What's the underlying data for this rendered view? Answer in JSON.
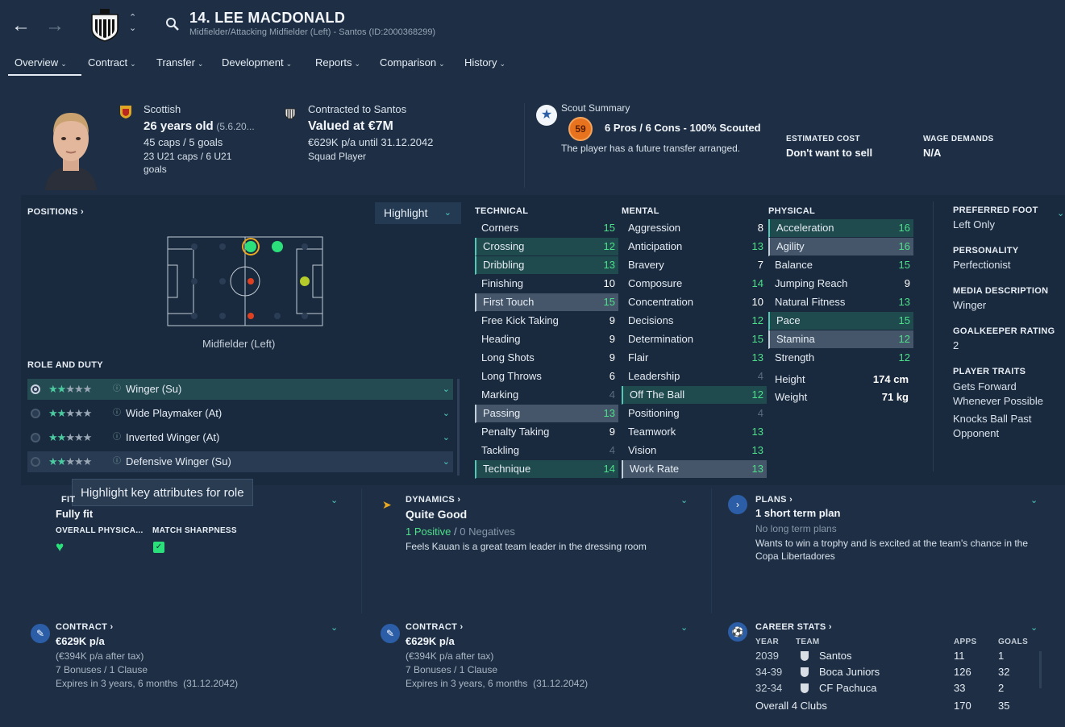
{
  "header": {
    "player_title": "14. LEE MACDONALD",
    "player_subtitle": "Midfielder/Attacking Midfielder (Left) - Santos (ID:2000368299)",
    "tabs": [
      "Overview",
      "Contract",
      "Transfer",
      "Development",
      "Reports",
      "Comparison",
      "History"
    ]
  },
  "info": {
    "nationality": "Scottish",
    "age": "26 years old",
    "dob": "(5.6.20...",
    "caps": "45 caps / 5 goals",
    "u21_caps": "23 U21 caps / 6 U21",
    "u21_goals": "goals",
    "contract_head": "Contracted to Santos",
    "value": "Valued at €7M",
    "wage": "€629K p/a until 31.12.2042",
    "squad_status": "Squad Player",
    "scout_head": "Scout Summary",
    "scout_rating": "59",
    "scout_line": "6 Pros / 6 Cons - 100% Scouted",
    "scout_note": "The player has a future transfer arranged.",
    "est_cost_label": "ESTIMATED COST",
    "est_cost_value": "Don't want to sell",
    "wage_demands_label": "WAGE DEMANDS",
    "wage_demands_value": "N/A"
  },
  "positions": {
    "label": "POSITIONS",
    "highlight": "Highlight",
    "position_name": "Midfielder (Left)",
    "role_duty_label": "ROLE AND DUTY",
    "roles": [
      {
        "stars_full": 2,
        "name": "Winger (Su)"
      },
      {
        "stars_full": 2,
        "name": "Wide Playmaker (At)"
      },
      {
        "stars_full": 2,
        "name": "Inverted Winger (At)"
      },
      {
        "stars_full": 2,
        "name": "Defensive Winger (Su)"
      }
    ],
    "tooltip": "Highlight key attributes for role"
  },
  "attributes": {
    "technical_label": "TECHNICAL",
    "mental_label": "MENTAL",
    "physical_label": "PHYSICAL",
    "technical": [
      {
        "name": "Corners",
        "value": "15",
        "style": "",
        "color": "g"
      },
      {
        "name": "Crossing",
        "value": "12",
        "style": "hl",
        "color": "g"
      },
      {
        "name": "Dribbling",
        "value": "13",
        "style": "hl",
        "color": "g"
      },
      {
        "name": "Finishing",
        "value": "10",
        "style": "",
        "color": "w"
      },
      {
        "name": "First Touch",
        "value": "15",
        "style": "gr",
        "color": "g"
      },
      {
        "name": "Free Kick Taking",
        "value": "9",
        "style": "",
        "color": "w"
      },
      {
        "name": "Heading",
        "value": "9",
        "style": "",
        "color": "w"
      },
      {
        "name": "Long Shots",
        "value": "9",
        "style": "",
        "color": "w"
      },
      {
        "name": "Long Throws",
        "value": "6",
        "style": "",
        "color": "w"
      },
      {
        "name": "Marking",
        "value": "4",
        "style": "",
        "color": "d"
      },
      {
        "name": "Passing",
        "value": "13",
        "style": "gr",
        "color": "g"
      },
      {
        "name": "Penalty Taking",
        "value": "9",
        "style": "",
        "color": "w"
      },
      {
        "name": "Tackling",
        "value": "4",
        "style": "",
        "color": "d"
      },
      {
        "name": "Technique",
        "value": "14",
        "style": "hl",
        "color": "g"
      }
    ],
    "mental": [
      {
        "name": "Aggression",
        "value": "8",
        "style": "",
        "color": "w"
      },
      {
        "name": "Anticipation",
        "value": "13",
        "style": "",
        "color": "g"
      },
      {
        "name": "Bravery",
        "value": "7",
        "style": "",
        "color": "w"
      },
      {
        "name": "Composure",
        "value": "14",
        "style": "",
        "color": "g"
      },
      {
        "name": "Concentration",
        "value": "10",
        "style": "",
        "color": "w"
      },
      {
        "name": "Decisions",
        "value": "12",
        "style": "",
        "color": "g"
      },
      {
        "name": "Determination",
        "value": "15",
        "style": "",
        "color": "g"
      },
      {
        "name": "Flair",
        "value": "13",
        "style": "",
        "color": "g"
      },
      {
        "name": "Leadership",
        "value": "4",
        "style": "",
        "color": "d"
      },
      {
        "name": "Off The Ball",
        "value": "12",
        "style": "hl",
        "color": "g"
      },
      {
        "name": "Positioning",
        "value": "4",
        "style": "",
        "color": "d"
      },
      {
        "name": "Teamwork",
        "value": "13",
        "style": "",
        "color": "g"
      },
      {
        "name": "Vision",
        "value": "13",
        "style": "",
        "color": "g"
      },
      {
        "name": "Work Rate",
        "value": "13",
        "style": "gr",
        "color": "g"
      }
    ],
    "physical": [
      {
        "name": "Acceleration",
        "value": "16",
        "style": "hl",
        "color": "g"
      },
      {
        "name": "Agility",
        "value": "16",
        "style": "gr",
        "color": "g"
      },
      {
        "name": "Balance",
        "value": "15",
        "style": "",
        "color": "g"
      },
      {
        "name": "Jumping Reach",
        "value": "9",
        "style": "",
        "color": "w"
      },
      {
        "name": "Natural Fitness",
        "value": "13",
        "style": "",
        "color": "g"
      },
      {
        "name": "Pace",
        "value": "15",
        "style": "hl",
        "color": "g"
      },
      {
        "name": "Stamina",
        "value": "12",
        "style": "gr",
        "color": "g"
      },
      {
        "name": "Strength",
        "value": "12",
        "style": "",
        "color": "g"
      }
    ],
    "height_label": "Height",
    "height_value": "174 cm",
    "weight_label": "Weight",
    "weight_value": "71 kg"
  },
  "profile": {
    "preferred_foot_label": "PREFERRED FOOT",
    "preferred_foot_value": "Left Only",
    "personality_label": "PERSONALITY",
    "personality_value": "Perfectionist",
    "media_label": "MEDIA DESCRIPTION",
    "media_value": "Winger",
    "gk_label": "GOALKEEPER RATING",
    "gk_value": "2",
    "traits_label": "PLAYER TRAITS",
    "traits": [
      "Gets Forward Whenever Possible",
      "Knocks Ball Past Opponent"
    ]
  },
  "fitness": {
    "head": "FIT",
    "status": "Fully fit",
    "overall_label": "OVERALL PHYSICA...",
    "sharpness_label": "MATCH SHARPNESS"
  },
  "dynamics": {
    "head": "DYNAMICS",
    "status": "Quite Good",
    "positives": "1 Positive",
    "sep": "/",
    "negatives": "0 Negatives",
    "note": "Feels Kauan is a great team leader in the dressing room"
  },
  "plans": {
    "head": "PLANS",
    "status": "1 short term plan",
    "long": "No long term plans",
    "note": "Wants to win a trophy and is excited at the team's chance in the Copa Libertadores"
  },
  "contract_cards": [
    {
      "head": "CONTRACT",
      "wage": "€629K p/a",
      "after_tax": "(€394K p/a after tax)",
      "bonuses": "7 Bonuses / 1 Clause",
      "expires": "Expires in 3 years, 6 months  (31.12.2042)"
    },
    {
      "head": "CONTRACT",
      "wage": "€629K p/a",
      "after_tax": "(€394K p/a after tax)",
      "bonuses": "7 Bonuses / 1 Clause",
      "expires": "Expires in 3 years, 6 months  (31.12.2042)"
    }
  ],
  "career": {
    "head": "CAREER STATS",
    "cols": {
      "year": "YEAR",
      "team": "TEAM",
      "apps": "APPS",
      "goals": "GOALS"
    },
    "rows": [
      {
        "year": "2039",
        "team": "Santos",
        "apps": "11",
        "goals": "1"
      },
      {
        "year": "34-39",
        "team": "Boca Juniors",
        "apps": "126",
        "goals": "32"
      },
      {
        "year": "32-34",
        "team": "CF Pachuca",
        "apps": "33",
        "goals": "2"
      }
    ],
    "overall_label": "Overall",
    "overall_clubs": "4 Clubs",
    "overall_apps": "170",
    "overall_goals": "35"
  }
}
